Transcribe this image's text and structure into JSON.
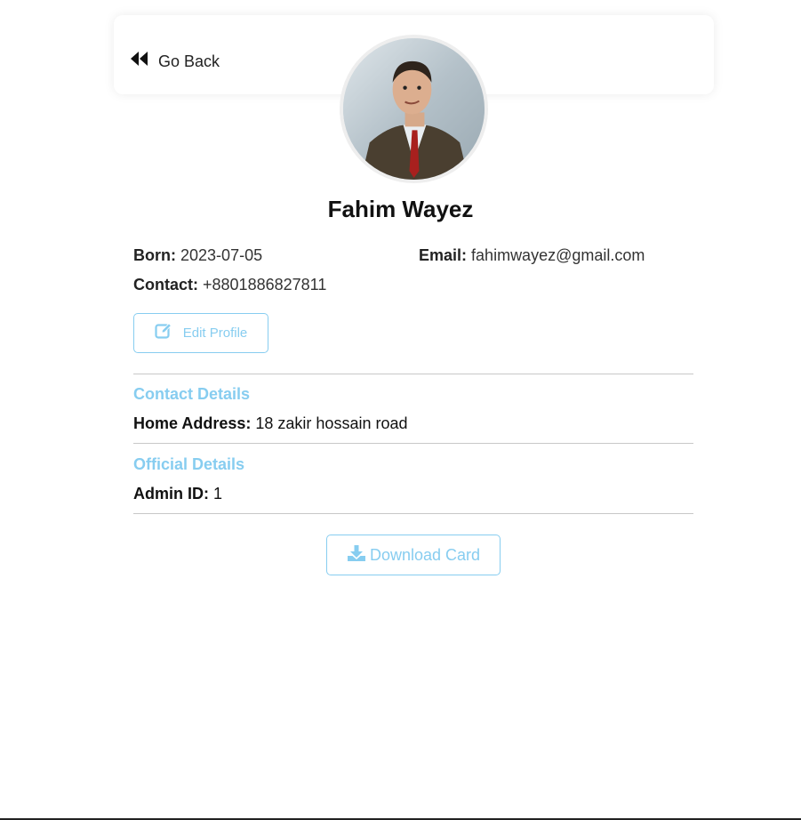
{
  "nav": {
    "back_label": "Go Back"
  },
  "profile": {
    "name": "Fahim Wayez",
    "born_label": "Born:",
    "born_value": "2023-07-05",
    "email_label": "Email:",
    "email_value": "fahimwayez@gmail.com",
    "contact_label": "Contact:",
    "contact_value": "+8801886827811",
    "edit_label": "Edit Profile"
  },
  "contact_details": {
    "title": "Contact Details",
    "address_label": "Home Address:",
    "address_value": "18 zakir hossain road"
  },
  "official_details": {
    "title": "Official Details",
    "admin_label": "Admin ID:",
    "admin_value": "1"
  },
  "actions": {
    "download_label": "Download Card"
  },
  "icons": {
    "back": "double-left-arrow-icon",
    "edit": "edit-pen-square-icon",
    "download": "download-icon"
  },
  "colors": {
    "accent": "#87cdf0",
    "text": "#222222",
    "divider": "#c8c8c8"
  }
}
